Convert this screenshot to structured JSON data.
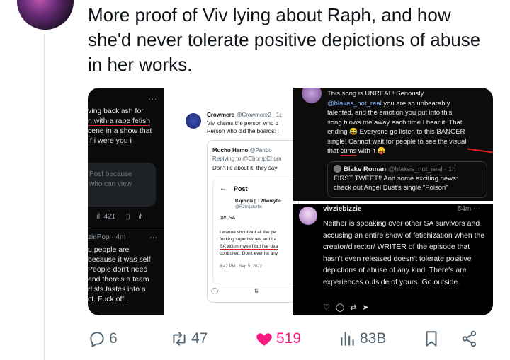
{
  "tweet": {
    "text": "More proof of Viv lying about Raph, and how she'd never tolerate positive depictions of abuse in her works."
  },
  "media": {
    "panel1": {
      "more": "...",
      "lines": [
        "ving backlash for",
        "n with a rape fetish",
        "cene in a show that",
        "If i were you i"
      ],
      "blurred": [
        "Post because",
        "who can view"
      ],
      "views": "421",
      "author_time": "ziePop · 4m",
      "reply_lines": [
        "u people are",
        "because it was self",
        "People don't need",
        "and there's a team",
        "rtists tastes into a",
        "ct. Fuck off."
      ]
    },
    "panel2": {
      "name": "Crowmere",
      "handle": "@Crowmere2 · 1ε",
      "line1": "Viv, claims the person who d",
      "line2": "Person who did the boards: I",
      "reply_name": "Mucho Hemo",
      "reply_handle": "@PanLo",
      "replying": "Replying to @ChompChom",
      "reply_text": "Don't lie about it, they say",
      "back": "←",
      "post_label": "Post",
      "inner_name": "Raphidle || : Whereybo",
      "inner_handle": "@R2mijaturtle",
      "tw": "Tw: SA",
      "inner_1": "I wanna shout out all the pe",
      "inner_2": "fucking superheroes and I a",
      "inner_3": "SA victim myself but i've dea",
      "inner_4": "controlled. Don't ever let any",
      "inner_time": "8:47 PM · Sep 5, 2022"
    },
    "panel3": {
      "l1": "This song is UNREAL! Seriously",
      "mention": "@blakes_not_real",
      "l2": " you are so unbearably",
      "l3": "talented, and the emotion you put into this",
      "l4": "song blows me away each time I hear it. That",
      "l5": "ending 😂 Everyone go listen to this BANGER",
      "l6": "single! Cannot wait for people to see the visual",
      "l7a": "that ",
      "l7b": "cums",
      "l7c": " with it 😛",
      "q_name": "Blake Roman",
      "q_handle": " @blakes_not_real · 1h",
      "q1": "FIRST TWEET!! And some exciting news:",
      "q2": "check out Angel Dust's single \"Poison\""
    },
    "panel4": {
      "name": "vivziebizzie",
      "time": "54m",
      "more": "···",
      "body": "Neither is speaking over other SA survivors and accusing an entire show of fetishization when the creator/director/ WRITER of the episode that hasn't even released doesn't tolerate positive depictions of abuse of any kind. There's are experiences outside of yours. Go outside."
    }
  },
  "actions": {
    "replies": "6",
    "retweets": "47",
    "likes": "519",
    "views": "83B"
  }
}
